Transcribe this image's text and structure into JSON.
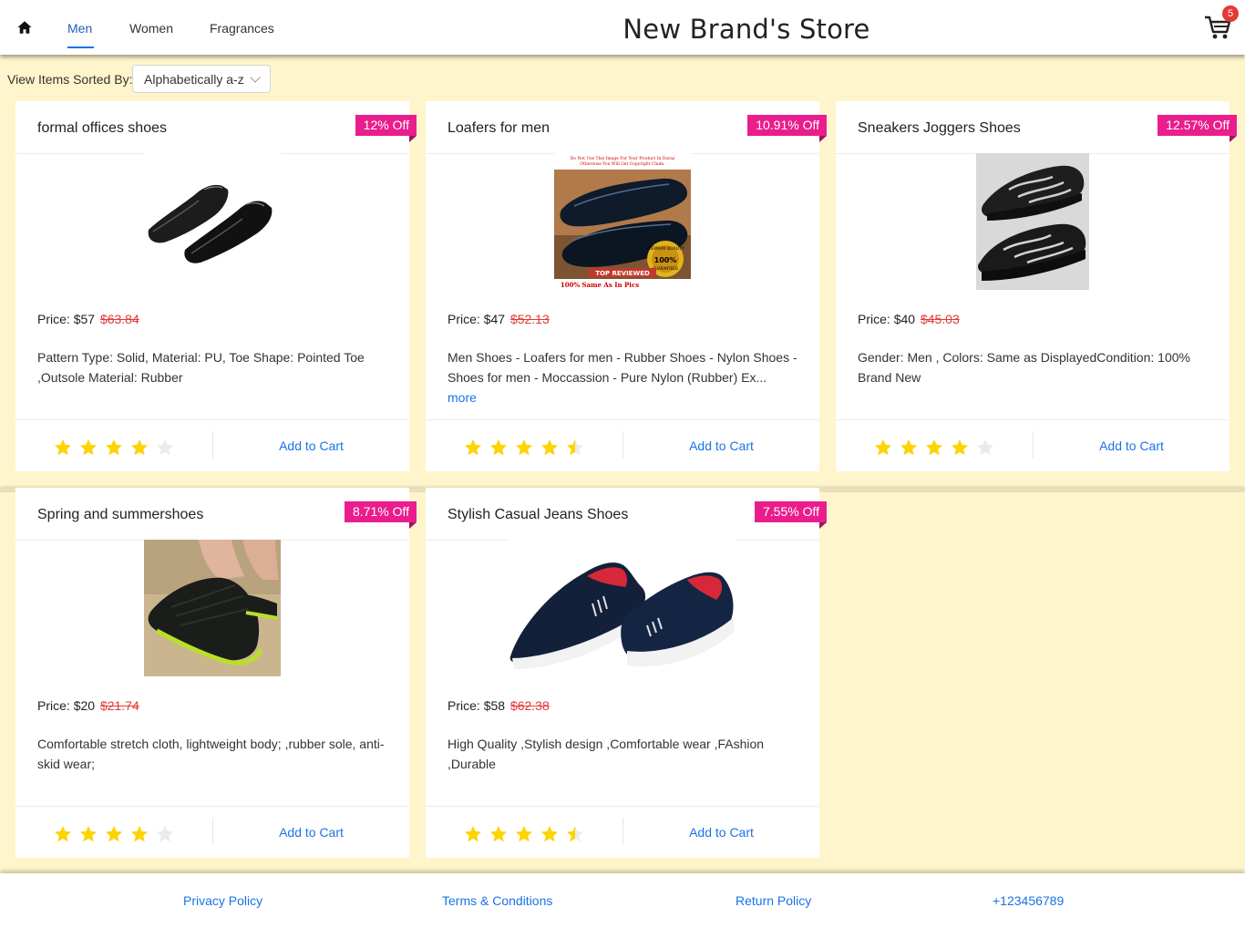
{
  "header": {
    "home_icon": "home-icon",
    "tabs": [
      "Men",
      "Women",
      "Fragrances"
    ],
    "active_tab": "Men",
    "store_title": "New Brand's Store",
    "cart_icon": "shopping-cart-icon",
    "cart_count": "5"
  },
  "sort": {
    "label": "View Items Sorted By:",
    "selected": "Alphabetically a-z"
  },
  "colors": {
    "page_bg": "#fff5cc",
    "discount_badge": "#e91e8c",
    "link": "#1a73e8",
    "old_price": "#e53935",
    "star_filled": "#fdd400",
    "star_empty": "#ebebeb"
  },
  "products": [
    {
      "title": "formal offices shoes",
      "discount": "12% Off",
      "price_label": "Price:",
      "price": "$57",
      "old_price": "$63.84",
      "description": "Pattern Type: Solid, Material: PU, Toe Shape: Pointed Toe ,Outsole Material: Rubber",
      "more": "",
      "rating": 4,
      "add_to_cart": "Add to Cart",
      "image": "black-formal-shoes"
    },
    {
      "title": "Loafers for men",
      "discount": "10.91% Off",
      "price_label": "Price:",
      "price": "$47",
      "old_price": "$52.13",
      "description": "Men Shoes - Loafers for men - Rubber Shoes - Nylon Shoes - Shoes for men - Moccassion - Pure Nylon (Rubber) Ex...",
      "more": "more",
      "rating": 4.5,
      "add_to_cart": "Add to Cart",
      "image": "black-loafers-photo",
      "image_texts": [
        "Do Not Use This Image For Your Product In Daraz",
        "Otherwise You Will Get Copyright Claim.",
        "PREMIUM QUALITY",
        "100%",
        "GUARANTEED",
        "TOP REVIEWED",
        "100% Same As In Pics"
      ]
    },
    {
      "title": "Sneakers Joggers Shoes",
      "discount": "12.57% Off",
      "price_label": "Price:",
      "price": "$40",
      "old_price": "$45.03",
      "description": "Gender: Men , Colors: Same as DisplayedCondition: 100% Brand New",
      "more": "",
      "rating": 4,
      "add_to_cart": "Add to Cart",
      "image": "black-sneakers"
    },
    {
      "title": "Spring and summershoes",
      "discount": "8.71% Off",
      "price_label": "Price:",
      "price": "$20",
      "old_price": "$21.74",
      "description": "Comfortable stretch cloth, lightweight body; ,rubber sole, anti-skid wear;",
      "more": "",
      "rating": 4,
      "add_to_cart": "Add to Cart",
      "image": "water-shoes-on-sand"
    },
    {
      "title": "Stylish Casual Jeans Shoes",
      "discount": "7.55% Off",
      "price_label": "Price:",
      "price": "$58",
      "old_price": "$62.38",
      "description": "High Quality ,Stylish design ,Comfortable wear ,FAshion ,Durable",
      "more": "",
      "rating": 4.5,
      "add_to_cart": "Add to Cart",
      "image": "navy-slip-on-shoes"
    }
  ],
  "footer": {
    "links": [
      "Privacy Policy",
      "Terms & Conditions",
      "Return Policy",
      "+123456789"
    ]
  }
}
